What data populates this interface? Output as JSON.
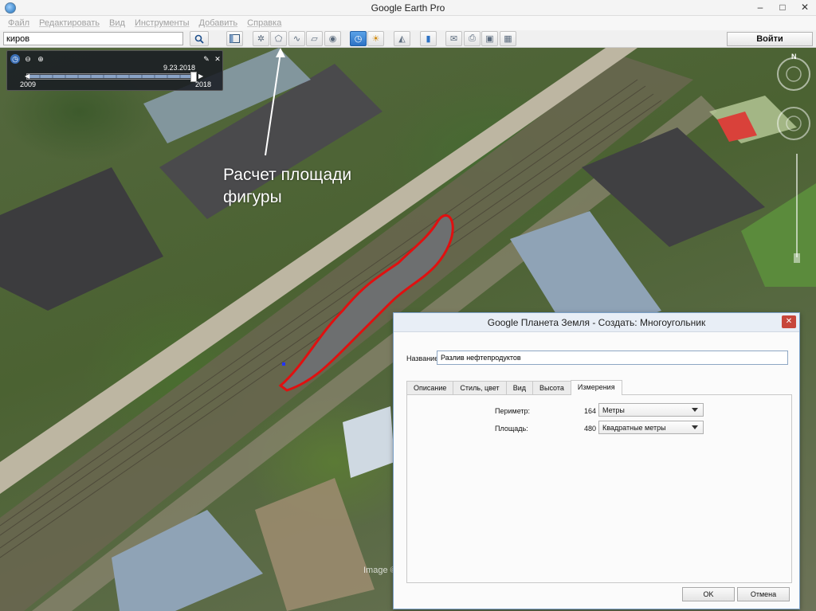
{
  "window": {
    "title": "Google Earth Pro",
    "minimize": "–",
    "maximize": "□",
    "close": "✕"
  },
  "menu": [
    "Файл",
    "Редактировать",
    "Вид",
    "Инструменты",
    "Добавить",
    "Справка"
  ],
  "toolbar": {
    "search_value": "киров",
    "login_label": "Войти"
  },
  "time_slider": {
    "date": "9.23.2018",
    "start_year": "2009",
    "end_year": "2018"
  },
  "navigation": {
    "north_label": "N"
  },
  "annotation": {
    "text": "Расчет площади фигуры"
  },
  "map": {
    "watermark": "Image ©"
  },
  "dialog": {
    "title": "Google Планета Земля - Создать: Многоугольник",
    "name_label": "Название:",
    "name_value": "Разлив нефтепродуктов",
    "tabs": [
      "Описание",
      "Стиль, цвет",
      "Вид",
      "Высота",
      "Измерения"
    ],
    "active_tab": "Измерения",
    "measurements": {
      "perimeter_label": "Периметр:",
      "perimeter_value": "164",
      "perimeter_unit": "Метры",
      "area_label": "Площадь:",
      "area_value": "480",
      "area_unit": "Квадратные метры"
    },
    "ok_label": "OK",
    "cancel_label": "Отмена"
  },
  "colors": {
    "polygon_outline": "#e01010",
    "active_button": "#2d72c4",
    "close_button": "#c7463b"
  }
}
